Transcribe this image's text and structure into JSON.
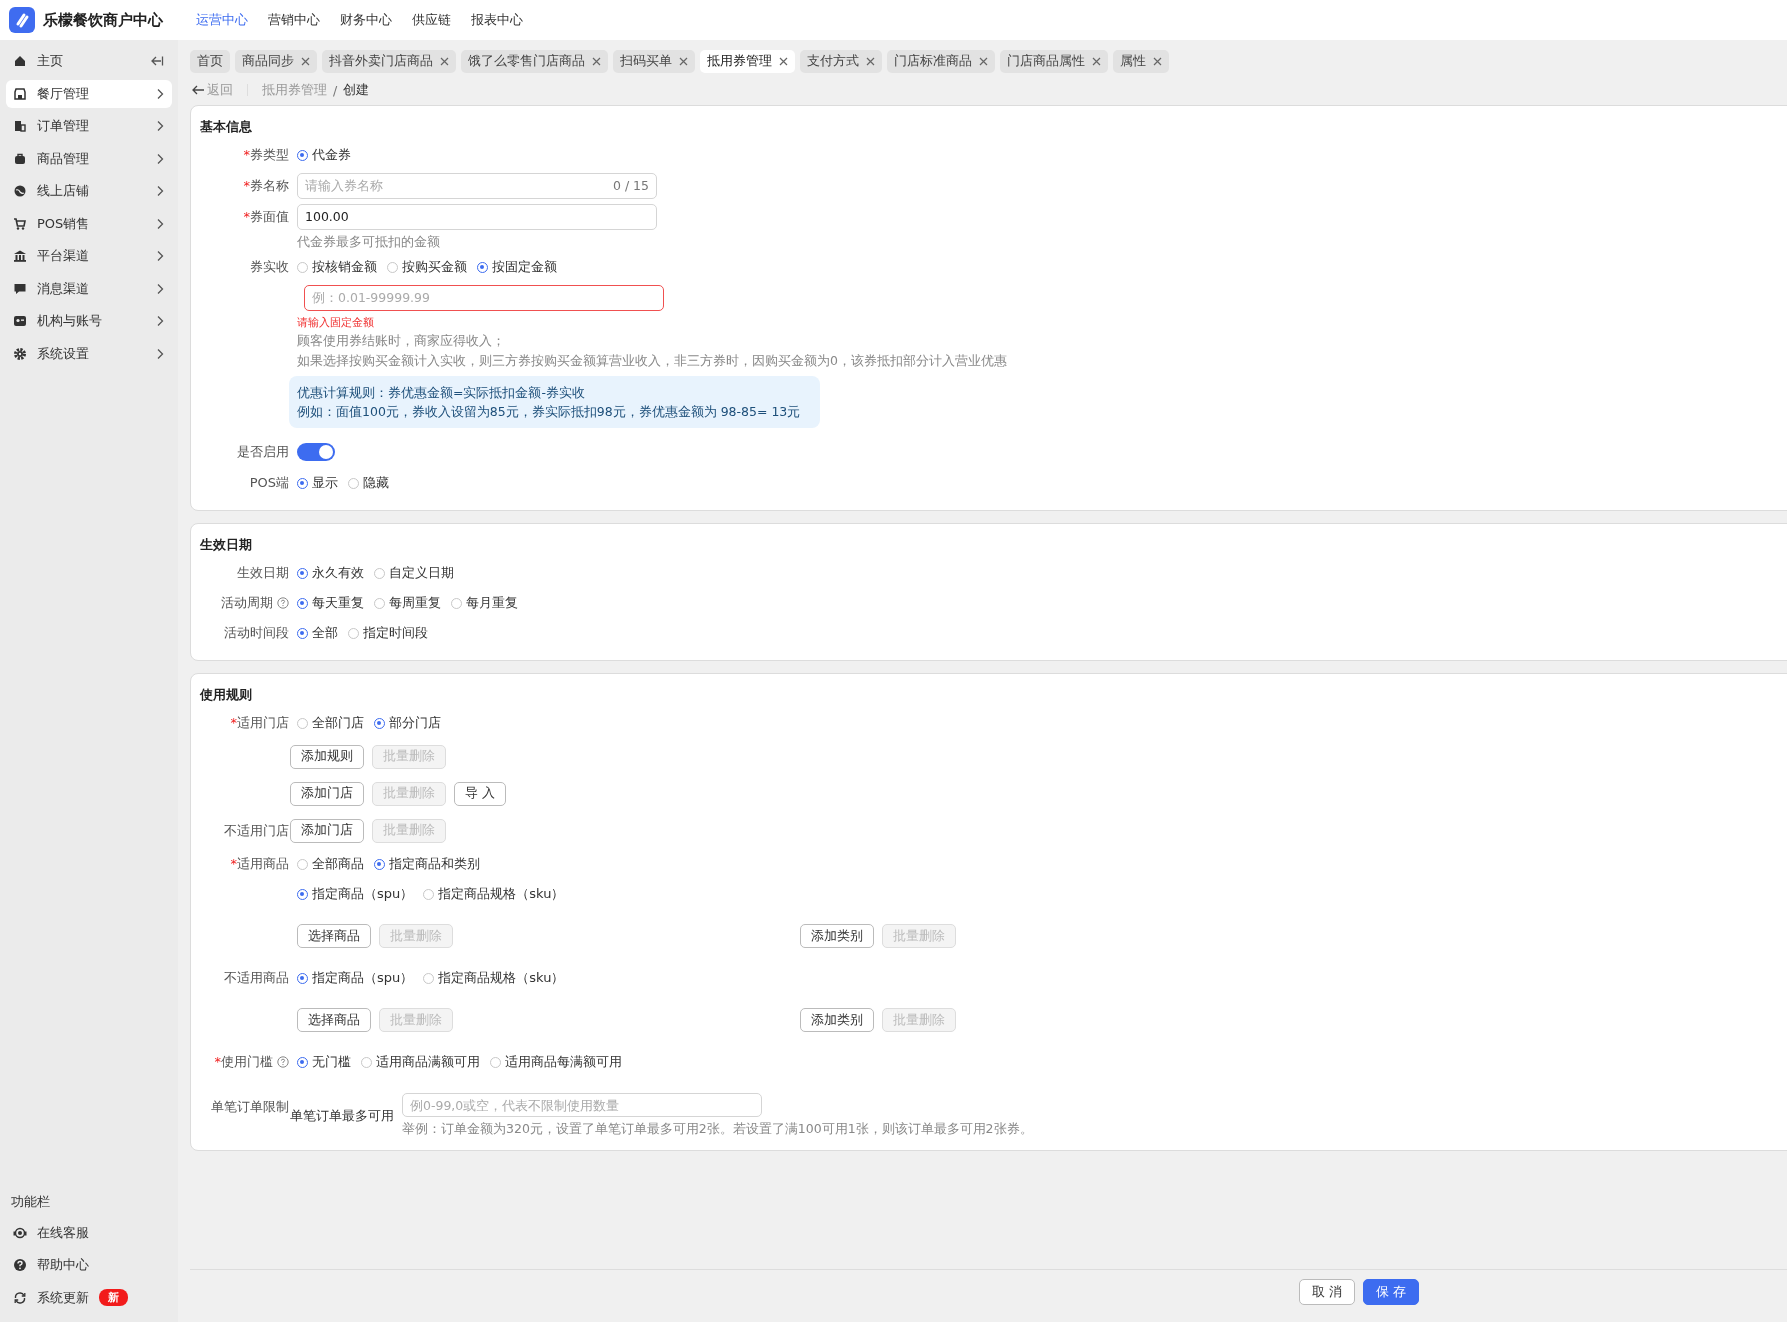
{
  "header": {
    "title": "乐檬餐饮商户中心",
    "nav": [
      {
        "label": "运营中心",
        "selected": true
      },
      {
        "label": "营销中心",
        "selected": false
      },
      {
        "label": "财务中心",
        "selected": false
      },
      {
        "label": "供应链",
        "selected": false
      },
      {
        "label": "报表中心",
        "selected": false
      }
    ]
  },
  "sidebar": {
    "items": [
      {
        "label": "主页",
        "selected": false,
        "expandable": false
      },
      {
        "label": "餐厅管理",
        "selected": true,
        "expandable": true
      },
      {
        "label": "订单管理",
        "selected": false,
        "expandable": true
      },
      {
        "label": "商品管理",
        "selected": false,
        "expandable": true
      },
      {
        "label": "线上店铺",
        "selected": false,
        "expandable": true
      },
      {
        "label": "POS销售",
        "selected": false,
        "expandable": true
      },
      {
        "label": "平台渠道",
        "selected": false,
        "expandable": true
      },
      {
        "label": "消息渠道",
        "selected": false,
        "expandable": true
      },
      {
        "label": "机构与账号",
        "selected": false,
        "expandable": true
      },
      {
        "label": "系统设置",
        "selected": false,
        "expandable": true
      }
    ],
    "footer_title": "功能栏",
    "footer_items": [
      {
        "label": "在线客服"
      },
      {
        "label": "帮助中心"
      },
      {
        "label": "系统更新",
        "badge": "新"
      }
    ]
  },
  "tabs": [
    {
      "label": "首页",
      "selected": false,
      "closable": false
    },
    {
      "label": "商品同步",
      "selected": false,
      "closable": true
    },
    {
      "label": "抖音外卖门店商品",
      "selected": false,
      "closable": true
    },
    {
      "label": "饿了么零售门店商品",
      "selected": false,
      "closable": true
    },
    {
      "label": "扫码买单",
      "selected": false,
      "closable": true
    },
    {
      "label": "抵用券管理",
      "selected": true,
      "closable": true
    },
    {
      "label": "支付方式",
      "selected": false,
      "closable": true
    },
    {
      "label": "门店标准商品",
      "selected": false,
      "closable": true
    },
    {
      "label": "门店商品属性",
      "selected": false,
      "closable": true
    },
    {
      "label": "属性",
      "selected": false,
      "closable": true
    }
  ],
  "breadcrumb": {
    "back": "返回",
    "path": [
      "抵用券管理",
      "创建"
    ],
    "separator": "/"
  },
  "sections": [
    {
      "title": "基本信息",
      "rows": [
        {
          "kind": "radio",
          "label": "券类型",
          "mark": "*",
          "help": false,
          "options": [
            {
              "label": "代金券",
              "selected": true
            }
          ]
        },
        {
          "kind": "input",
          "label": "券名称",
          "mark": "*",
          "help": false,
          "placeholder": "请输入券名称",
          "counter": "0 / 15",
          "error": false
        },
        {
          "kind": "input",
          "label": "券面值",
          "mark": "*",
          "help": false,
          "value": "100.00",
          "error": false
        },
        {
          "kind": "note",
          "text": "代金券最多可抵扣的金额"
        },
        {
          "kind": "radio",
          "label": "券实收",
          "help": false,
          "options": [
            {
              "label": "按核销金额",
              "selected": false
            },
            {
              "label": "按购买金额",
              "selected": false
            },
            {
              "label": "按固定金额",
              "selected": true
            }
          ]
        },
        {
          "kind": "input",
          "placeholder": "例：0.01-99999.99",
          "error": true
        },
        {
          "kind": "error_text",
          "text": "请输入固定金额"
        },
        {
          "kind": "note",
          "text": "顾客使用券结账时，商家应得收入；"
        },
        {
          "kind": "note",
          "text": "如果选择按购买金额计入实收，则三方券按购买金额算营业收入，非三方券时，因购买金额为0，该券抵扣部分计入营业优惠"
        },
        {
          "kind": "info",
          "lines": [
            "优惠计算规则：券优惠金额=实际抵扣金额-券实收",
            "例如：面值100元，券收入设留为85元，券实际抵扣98元，券优惠金额为 98-85= 13元"
          ]
        },
        {
          "kind": "switch",
          "label": "是否启用",
          "help": false,
          "on": true
        },
        {
          "kind": "radio",
          "label": "POS端",
          "help": false,
          "options": [
            {
              "label": "显示",
              "selected": true
            },
            {
              "label": "隐藏",
              "selected": false
            }
          ]
        }
      ]
    },
    {
      "title": "生效日期",
      "rows": [
        {
          "kind": "radio",
          "label": "生效日期",
          "help": false,
          "options": [
            {
              "label": "永久有效",
              "selected": true
            },
            {
              "label": "自定义日期",
              "selected": false
            }
          ]
        },
        {
          "kind": "radio",
          "label": "活动周期",
          "help": true,
          "options": [
            {
              "label": "每天重复",
              "selected": true
            },
            {
              "label": "每周重复",
              "selected": false
            },
            {
              "label": "每月重复",
              "selected": false
            }
          ]
        },
        {
          "kind": "radio",
          "label": "活动时间段",
          "help": false,
          "options": [
            {
              "label": "全部",
              "selected": true
            },
            {
              "label": "指定时间段",
              "selected": false
            }
          ]
        }
      ]
    },
    {
      "title": "使用规则",
      "rows": [
        {
          "kind": "radio",
          "label": "适用门店",
          "mark": "*",
          "help": false,
          "options": [
            {
              "label": "全部门店",
              "selected": false
            },
            {
              "label": "部分门店",
              "selected": true
            }
          ]
        },
        {
          "kind": "buttons",
          "groups": [
            [
              {
                "label": "添加规则",
                "disabled": false
              },
              {
                "label": "批量删除",
                "disabled": true
              }
            ]
          ]
        },
        {
          "kind": "buttons",
          "groups": [
            [
              {
                "label": "添加门店",
                "disabled": false
              },
              {
                "label": "批量删除",
                "disabled": true
              },
              {
                "label": "导 入",
                "disabled": false
              }
            ]
          ]
        },
        {
          "kind": "buttons",
          "label": "不适用门店",
          "help": false,
          "groups": [
            [
              {
                "label": "添加门店",
                "disabled": false
              },
              {
                "label": "批量删除",
                "disabled": true
              }
            ]
          ]
        },
        {
          "kind": "radio",
          "label": "适用商品",
          "mark": "*",
          "help": false,
          "options": [
            {
              "label": "全部商品",
              "selected": false
            },
            {
              "label": "指定商品和类别",
              "selected": true
            }
          ]
        },
        {
          "kind": "radio",
          "options": [
            {
              "label": "指定商品（spu）",
              "selected": true
            },
            {
              "label": "指定商品规格（sku）",
              "selected": false
            }
          ]
        },
        {
          "kind": "buttons",
          "groups": [
            [
              {
                "label": "选择商品",
                "disabled": false
              },
              {
                "label": "批量删除",
                "disabled": true
              }
            ],
            [
              {
                "label": "添加类别",
                "disabled": false
              },
              {
                "label": "批量删除",
                "disabled": true
              }
            ]
          ]
        },
        {
          "kind": "radio",
          "label": "不适用商品",
          "help": false,
          "options": [
            {
              "label": "指定商品（spu）",
              "selected": true
            },
            {
              "label": "指定商品规格（sku）",
              "selected": false
            }
          ]
        },
        {
          "kind": "buttons",
          "groups": [
            [
              {
                "label": "选择商品",
                "disabled": false
              },
              {
                "label": "批量删除",
                "disabled": true
              }
            ],
            [
              {
                "label": "添加类别",
                "disabled": false
              },
              {
                "label": "批量删除",
                "disabled": true
              }
            ]
          ]
        },
        {
          "kind": "radio",
          "label": "使用门槛",
          "mark": "*",
          "help": true,
          "options": [
            {
              "label": "无门槛",
              "selected": true
            },
            {
              "label": "适用商品满额可用",
              "selected": false
            },
            {
              "label": "适用商品每满额可用",
              "selected": false
            }
          ]
        },
        {
          "kind": "limit",
          "label": "单笔订单限制",
          "help": false,
          "sublabel": "单笔订单最多可用",
          "placeholder": "例0-99,0或空，代表不限制使用数量",
          "note": "举例：订单金额为320元，设置了单笔订单最多可用2张。若设置了满100可用1张，则该订单最多可用2张券。"
        }
      ]
    }
  ],
  "footer": {
    "buttons": [
      {
        "label": "取 消",
        "kind": "default"
      },
      {
        "label": "保 存",
        "kind": "primary"
      }
    ]
  }
}
